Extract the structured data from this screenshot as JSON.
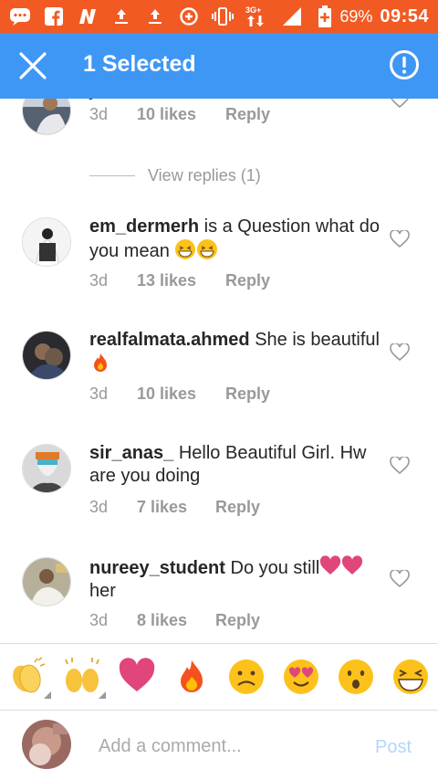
{
  "status_bar": {
    "network": "3G",
    "battery_percent": "69%",
    "time": "09:54",
    "color": "#f25a23"
  },
  "action_bar": {
    "title": "1 Selected",
    "color": "#3f97f5"
  },
  "comments": [
    {
      "username": "jaeednawaaa",
      "text": "",
      "time": "3d",
      "likes": "10 likes",
      "reply": "Reply",
      "view_replies": "View replies (1)"
    },
    {
      "username": "em_dermerh",
      "text": " is a Question  what do you mean",
      "time": "3d",
      "likes": "13 likes",
      "reply": "Reply"
    },
    {
      "username": "realfalmata.ahmed",
      "text": " She is beautiful",
      "time": "3d",
      "likes": "10 likes",
      "reply": "Reply"
    },
    {
      "username": "sir_anas_",
      "text": " Hello Beautiful Girl. Hw are you doing",
      "time": "3d",
      "likes": "7 likes",
      "reply": "Reply"
    },
    {
      "username": "nureey_student",
      "text_a": " Do you still",
      "text_b": "her",
      "time": "3d",
      "likes": "8 likes",
      "reply": "Reply"
    }
  ],
  "emoji_bar": [
    "clapping-hands",
    "raising-hands",
    "red-heart",
    "fire",
    "frowning-face",
    "heart-eyes",
    "astonished",
    "grinning-squinting"
  ],
  "composer": {
    "placeholder": "Add a comment...",
    "post_label": "Post"
  }
}
